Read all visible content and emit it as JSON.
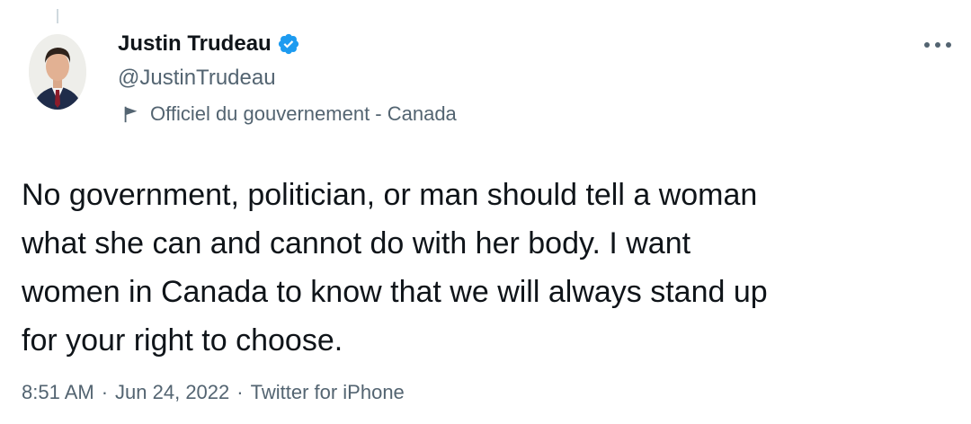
{
  "tweet": {
    "author": {
      "display_name": "Justin Trudeau",
      "handle": "@JustinTrudeau",
      "verified": true,
      "verified_color": "#1d9bf0",
      "affiliation": "Officiel du gouvernement - Canada",
      "affiliation_icon": "flag-icon",
      "avatar_icon": "avatar"
    },
    "text": "No government, politician, or man should tell a woman\nwhat she can and cannot do with her body. I want\nwomen in Canada to know that we will always stand up\nfor your right to choose.",
    "time": "8:51 AM",
    "date": "Jun 24, 2022",
    "source": "Twitter for iPhone",
    "separator": "·",
    "more_icon": "more-icon"
  },
  "colors": {
    "text_primary": "#0f1419",
    "text_secondary": "#536471",
    "accent": "#1d9bf0"
  }
}
